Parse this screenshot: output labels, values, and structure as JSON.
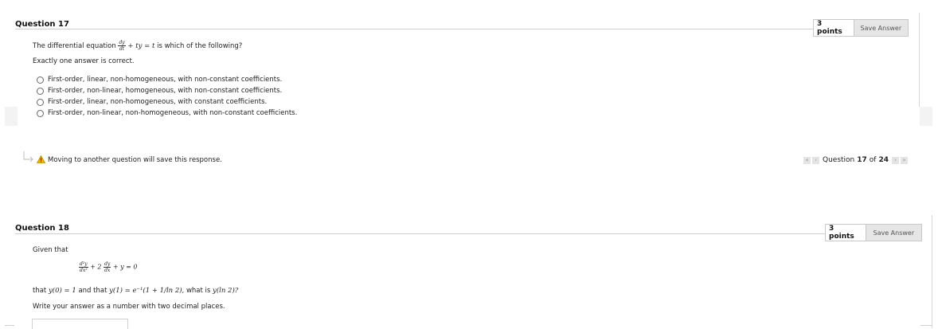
{
  "q17": {
    "title": "Question 17",
    "points": "3 points",
    "save_label": "Save Answer",
    "prompt_before": "The differential equation",
    "prompt_after": "is which of the following?",
    "eq_num": "dy",
    "eq_den": "dt",
    "eq_rest": "+ ty = t",
    "instruction": "Exactly one answer is correct.",
    "options": [
      "First-order, linear, non-homogeneous, with non-constant coefficients.",
      "First-order, non-linear, homogeneous, with non-constant coefficients.",
      "First-order, linear, non-homogeneous, with constant coefficients.",
      "First-order, non-linear, non-homogeneous, with non-constant coefficients."
    ]
  },
  "warning": {
    "text": "Moving to another question will save this response."
  },
  "navigation": {
    "label_prefix": "Question",
    "current": "17",
    "of_label": "of",
    "total": "24",
    "first_icon": "«",
    "prev_icon": "‹",
    "next_icon": "›",
    "last_icon": "»"
  },
  "q18": {
    "title": "Question 18",
    "points": "3 points",
    "save_label": "Save Answer",
    "given": "Given that",
    "eq_d2_num": "d²y",
    "eq_d2_den": "dx²",
    "eq_plus2": "+ 2",
    "eq_d1_num": "dy",
    "eq_d1_den": "dx",
    "eq_tail": "+ y = 0",
    "that_text": "that",
    "cond1": "y(0) = 1",
    "and_text": "and that",
    "cond2": "y(1) = e⁻¹(1 + 1/ln 2),",
    "what_text": "what is",
    "target": "y(ln 2)?",
    "instruction": "Write your answer as a number with two decimal places."
  }
}
